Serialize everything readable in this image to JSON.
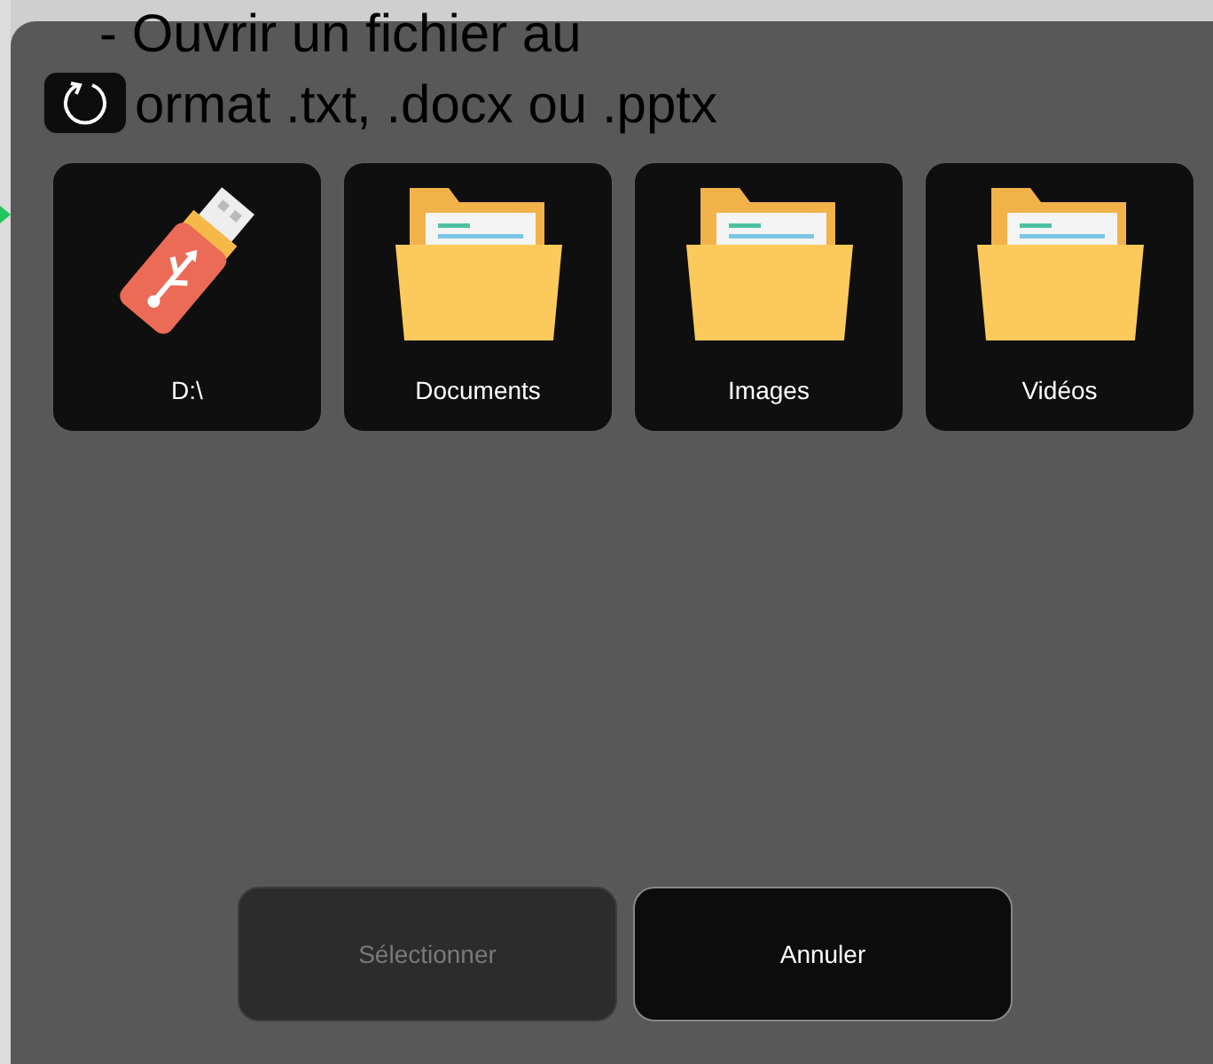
{
  "background_slide": {
    "lines": [
      "- Ouvrir un fichier au",
      "ormat .txt, .docx ou .pptx"
    ]
  },
  "dialog": {
    "locations": [
      {
        "kind": "drive",
        "label": "D:\\"
      },
      {
        "kind": "folder",
        "label": "Documents"
      },
      {
        "kind": "folder",
        "label": "Images"
      },
      {
        "kind": "folder",
        "label": "Vidéos"
      }
    ],
    "buttons": [
      {
        "label": "Sélectionner",
        "disabled": true
      },
      {
        "label": "Annuler",
        "disabled": false
      }
    ]
  }
}
